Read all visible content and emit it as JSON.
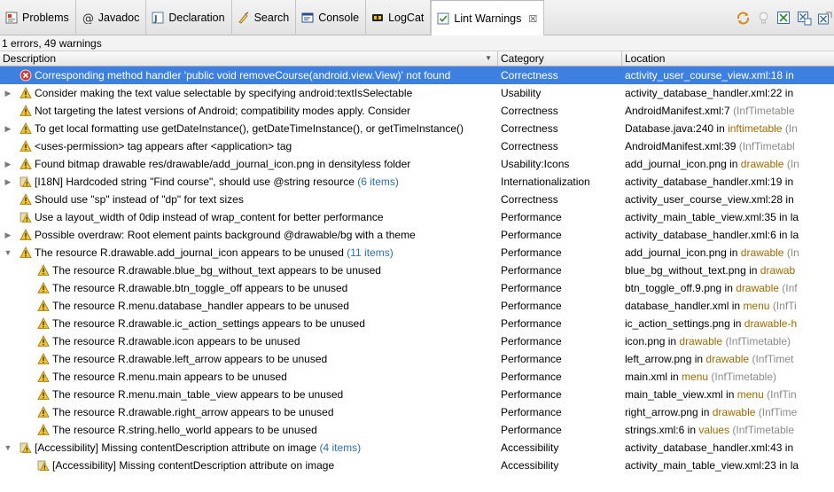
{
  "tabs": [
    {
      "label": "Problems",
      "icon": "problems-icon",
      "active": false
    },
    {
      "label": "Javadoc",
      "icon": "javadoc-icon",
      "active": false
    },
    {
      "label": "Declaration",
      "icon": "declaration-icon",
      "active": false
    },
    {
      "label": "Search",
      "icon": "search-icon",
      "active": false
    },
    {
      "label": "Console",
      "icon": "console-icon",
      "active": false
    },
    {
      "label": "LogCat",
      "icon": "logcat-icon",
      "active": false
    },
    {
      "label": "Lint Warnings",
      "icon": "lint-icon",
      "active": true,
      "close": "☒"
    }
  ],
  "toolbar": [
    "refresh-icon",
    "lightbulb-icon",
    "fix-icon",
    "ignore-icon",
    "ignore-all-icon"
  ],
  "summary": "1 errors, 49 warnings",
  "columns": {
    "description": "Description",
    "category": "Category",
    "location": "Location"
  },
  "colors": {
    "selection": "#3d80df",
    "warning": "#f1c232",
    "error": "#d9382b",
    "link": "#2a6fb0"
  },
  "rows": [
    {
      "level": 0,
      "twisty": "",
      "severity": "error",
      "selected": true,
      "description": "Corresponding method handler 'public void removeCourse(android.view.View)' not found",
      "count": "",
      "category": "Correctness",
      "location": "activity_user_course_view.xml:18 in",
      "folder": "",
      "project": ""
    },
    {
      "level": 0,
      "twisty": "right",
      "severity": "warning",
      "selected": false,
      "description": "Consider making the text value selectable by specifying android:textIsSelectable",
      "count": "",
      "category": "Usability",
      "location": "activity_database_handler.xml:22 in",
      "folder": "",
      "project": ""
    },
    {
      "level": 0,
      "twisty": "",
      "severity": "warning",
      "selected": false,
      "description": "Not targeting the latest versions of Android; compatibility modes apply. Consider",
      "count": "",
      "category": "Correctness",
      "location": "AndroidManifest.xml:7",
      "folder": "",
      "project": "(InfTimetable"
    },
    {
      "level": 0,
      "twisty": "right",
      "severity": "warning",
      "selected": false,
      "description": "To get local formatting use getDateInstance(), getDateTimeInstance(), or getTimeInstance()",
      "count": "",
      "category": "Correctness",
      "location": "Database.java:240 in",
      "folder": "inftimetable",
      "project": "(In"
    },
    {
      "level": 0,
      "twisty": "",
      "severity": "warning",
      "selected": false,
      "description": "<uses-permission> tag appears after <application> tag",
      "count": "",
      "category": "Correctness",
      "location": "AndroidManifest.xml:39",
      "folder": "",
      "project": "(InfTimetabl"
    },
    {
      "level": 0,
      "twisty": "right",
      "severity": "warning",
      "selected": false,
      "description": "Found bitmap drawable res/drawable/add_journal_icon.png in densityless folder",
      "count": "",
      "category": "Usability:Icons",
      "location": "add_journal_icon.png in",
      "folder": "drawable",
      "project": "(In"
    },
    {
      "level": 0,
      "twisty": "right",
      "severity": "i18n",
      "selected": false,
      "description": "[I18N] Hardcoded string \"Find course\", should use @string resource",
      "count": "(6 items)",
      "category": "Internationalization",
      "location": "activity_database_handler.xml:19 in",
      "folder": "",
      "project": ""
    },
    {
      "level": 0,
      "twisty": "",
      "severity": "warning",
      "selected": false,
      "description": "Should use \"sp\" instead of \"dp\" for text sizes",
      "count": "",
      "category": "Correctness",
      "location": "activity_user_course_view.xml:28 in",
      "folder": "",
      "project": ""
    },
    {
      "level": 0,
      "twisty": "",
      "severity": "perf",
      "selected": false,
      "description": "Use a layout_width of 0dip instead of wrap_content for better performance",
      "count": "",
      "category": "Performance",
      "location": "activity_main_table_view.xml:35 in la",
      "folder": "",
      "project": ""
    },
    {
      "level": 0,
      "twisty": "right",
      "severity": "warning",
      "selected": false,
      "description": "Possible overdraw: Root element paints background @drawable/bg with a theme",
      "count": "",
      "category": "Performance",
      "location": "activity_database_handler.xml:6 in la",
      "folder": "",
      "project": ""
    },
    {
      "level": 0,
      "twisty": "down",
      "severity": "warning",
      "selected": false,
      "description": "The resource R.drawable.add_journal_icon appears to be unused",
      "count": "(11 items)",
      "category": "Performance",
      "location": "add_journal_icon.png in",
      "folder": "drawable",
      "project": "(In"
    },
    {
      "level": 1,
      "twisty": "",
      "severity": "warning",
      "selected": false,
      "description": "The resource R.drawable.blue_bg_without_text appears to be unused",
      "count": "",
      "category": "Performance",
      "location": "blue_bg_without_text.png in",
      "folder": "drawab",
      "project": ""
    },
    {
      "level": 1,
      "twisty": "",
      "severity": "warning",
      "selected": false,
      "description": "The resource R.drawable.btn_toggle_off appears to be unused",
      "count": "",
      "category": "Performance",
      "location": "btn_toggle_off.9.png in",
      "folder": "drawable",
      "project": "(Inf"
    },
    {
      "level": 1,
      "twisty": "",
      "severity": "warning",
      "selected": false,
      "description": "The resource R.menu.database_handler appears to be unused",
      "count": "",
      "category": "Performance",
      "location": "database_handler.xml in",
      "folder": "menu",
      "project": "(InfTi"
    },
    {
      "level": 1,
      "twisty": "",
      "severity": "warning",
      "selected": false,
      "description": "The resource R.drawable.ic_action_settings appears to be unused",
      "count": "",
      "category": "Performance",
      "location": "ic_action_settings.png in",
      "folder": "drawable-h",
      "project": ""
    },
    {
      "level": 1,
      "twisty": "",
      "severity": "warning",
      "selected": false,
      "description": "The resource R.drawable.icon appears to be unused",
      "count": "",
      "category": "Performance",
      "location": "icon.png in",
      "folder": "drawable",
      "project": "(InfTimetable)"
    },
    {
      "level": 1,
      "twisty": "",
      "severity": "warning",
      "selected": false,
      "description": "The resource R.drawable.left_arrow appears to be unused",
      "count": "",
      "category": "Performance",
      "location": "left_arrow.png in",
      "folder": "drawable",
      "project": "(InfTimet"
    },
    {
      "level": 1,
      "twisty": "",
      "severity": "warning",
      "selected": false,
      "description": "The resource R.menu.main appears to be unused",
      "count": "",
      "category": "Performance",
      "location": "main.xml in",
      "folder": "menu",
      "project": "(InfTimetable)"
    },
    {
      "level": 1,
      "twisty": "",
      "severity": "warning",
      "selected": false,
      "description": "The resource R.menu.main_table_view appears to be unused",
      "count": "",
      "category": "Performance",
      "location": "main_table_view.xml in",
      "folder": "menu",
      "project": "(InfTin"
    },
    {
      "level": 1,
      "twisty": "",
      "severity": "warning",
      "selected": false,
      "description": "The resource R.drawable.right_arrow appears to be unused",
      "count": "",
      "category": "Performance",
      "location": "right_arrow.png in",
      "folder": "drawable",
      "project": "(InfTime"
    },
    {
      "level": 1,
      "twisty": "",
      "severity": "warning",
      "selected": false,
      "description": "The resource R.string.hello_world appears to be unused",
      "count": "",
      "category": "Performance",
      "location": "strings.xml:6 in",
      "folder": "values",
      "project": "(InfTimetable"
    },
    {
      "level": 0,
      "twisty": "down",
      "severity": "a11y",
      "selected": false,
      "description": "[Accessibility] Missing contentDescription attribute on image",
      "count": "(4 items)",
      "category": "Accessibility",
      "location": "activity_database_handler.xml:43 in",
      "folder": "",
      "project": ""
    },
    {
      "level": 1,
      "twisty": "",
      "severity": "a11y",
      "selected": false,
      "description": "[Accessibility] Missing contentDescription attribute on image",
      "count": "",
      "category": "Accessibility",
      "location": "activity_main_table_view.xml:23 in la",
      "folder": "",
      "project": ""
    }
  ]
}
